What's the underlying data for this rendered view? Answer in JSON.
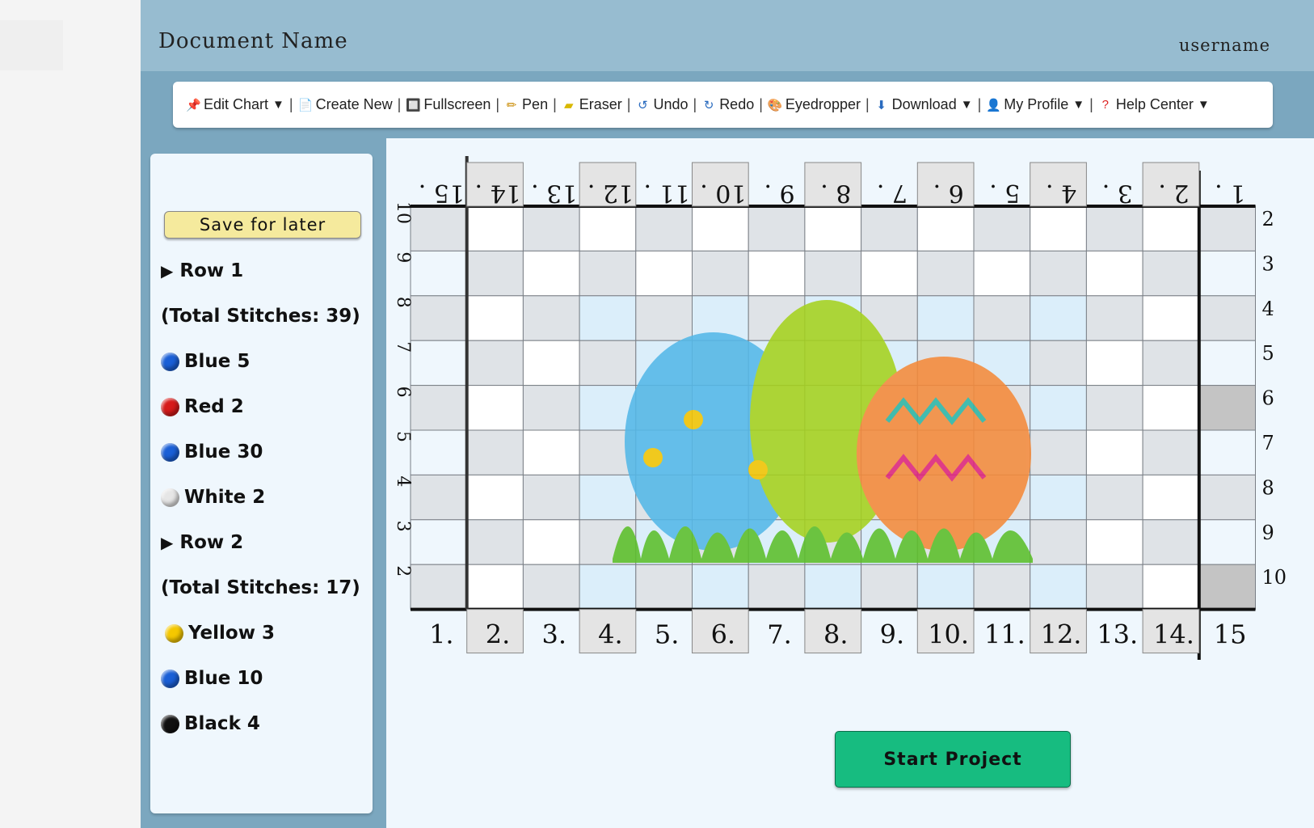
{
  "header": {
    "document_name": "Document Name",
    "username": "username"
  },
  "toolbar": {
    "items": [
      {
        "label": "Edit Chart",
        "icon": "pushpin-icon",
        "caret": true
      },
      {
        "label": "Create New",
        "icon": "page-icon",
        "caret": false
      },
      {
        "label": "Fullscreen",
        "icon": "fullscreen-icon",
        "caret": false
      },
      {
        "label": "Pen",
        "icon": "pencil-icon",
        "caret": false
      },
      {
        "label": "Eraser",
        "icon": "eraser-icon",
        "caret": false
      },
      {
        "label": "Undo",
        "icon": "undo-icon",
        "caret": false
      },
      {
        "label": "Redo",
        "icon": "redo-icon",
        "caret": false
      },
      {
        "label": "Eyedropper",
        "icon": "palette-icon",
        "caret": false
      },
      {
        "label": "Download",
        "icon": "download-icon",
        "caret": true
      },
      {
        "label": "My Profile",
        "icon": "user-icon",
        "caret": true
      },
      {
        "label": "Help Center",
        "icon": "question-icon",
        "caret": true
      }
    ]
  },
  "sidebar": {
    "save_label": "Save for later",
    "items": [
      {
        "type": "row",
        "label": "Row 1"
      },
      {
        "type": "total",
        "label": "(Total Stitches: 39)"
      },
      {
        "type": "color",
        "label": "Blue 5",
        "color": "#1a5fd6"
      },
      {
        "type": "color",
        "label": "Red 2",
        "color": "#d61a1a"
      },
      {
        "type": "color",
        "label": "Blue 30",
        "color": "#1a5fd6"
      },
      {
        "type": "color",
        "label": "White 2",
        "color": "#e6e6e6"
      },
      {
        "type": "row",
        "label": "Row 2"
      },
      {
        "type": "total",
        "label": "(Total Stitches: 17)"
      },
      {
        "type": "color",
        "label": "Yellow 3",
        "color": "#f5c800"
      },
      {
        "type": "color",
        "label": "Blue 10",
        "color": "#1a5fd6"
      },
      {
        "type": "color",
        "label": "Black 4",
        "color": "#111111"
      }
    ]
  },
  "grid": {
    "columns": 15,
    "rows": 9,
    "top_labels": [
      "1",
      ".",
      "2",
      ".",
      "3",
      ".",
      "4",
      ".",
      "5",
      ".",
      "6",
      ".",
      "7",
      ".",
      "8",
      ".",
      "9",
      ".",
      "10",
      ".",
      "11",
      ".",
      "12",
      ".",
      "13",
      ".",
      "14",
      ".",
      "15"
    ],
    "bottom_labels": [
      "1.",
      "2.",
      "3.",
      "4.",
      "5.",
      "6.",
      "7.",
      "8.",
      "9.",
      "10.",
      "11.",
      "12.",
      "13.",
      "14.",
      "15"
    ],
    "top_mirrored_labels": [
      "15",
      "14",
      "13",
      "12",
      "11",
      "10",
      "9",
      "8",
      "7",
      "6",
      "5",
      "4",
      "3",
      "2",
      "1"
    ],
    "right_labels": [
      "2",
      "3",
      "4",
      "5",
      "6",
      "7",
      "8",
      "9",
      "10"
    ],
    "left_labels": [
      "10",
      "9",
      "8",
      "7",
      "6",
      "5",
      "4",
      "3",
      "2"
    ]
  },
  "start_label": "Start Project"
}
